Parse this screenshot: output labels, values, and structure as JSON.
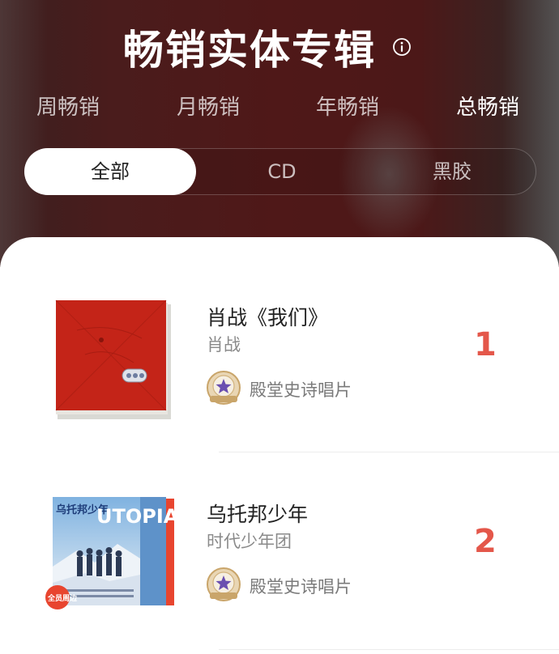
{
  "header": {
    "title": "畅销实体专辑",
    "info_icon": "info-icon"
  },
  "period_tabs": [
    {
      "label": "周畅销",
      "active": false
    },
    {
      "label": "月畅销",
      "active": false
    },
    {
      "label": "年畅销",
      "active": false
    },
    {
      "label": "总畅销",
      "active": true
    }
  ],
  "type_filter": [
    {
      "label": "全部",
      "active": true
    },
    {
      "label": "CD",
      "active": false
    },
    {
      "label": "黑胶",
      "active": false
    }
  ],
  "albums": [
    {
      "rank": "1",
      "title": "肖战《我们》",
      "artist": "肖战",
      "badge_label": "殿堂史诗唱片",
      "cover_icon": "album-cover-red"
    },
    {
      "rank": "2",
      "title": "乌托邦少年",
      "artist": "时代少年团",
      "badge_label": "殿堂史诗唱片",
      "cover_icon": "album-cover-utopia",
      "cover_text": {
        "top": "乌托邦少年",
        "side": "UTOPIA",
        "corner": "全员周边"
      }
    }
  ],
  "colors": {
    "rank": "#e4574a",
    "hero_bg": "#4f1818",
    "badge_gold": "#c9a56a",
    "badge_purple": "#6a4fb0"
  }
}
